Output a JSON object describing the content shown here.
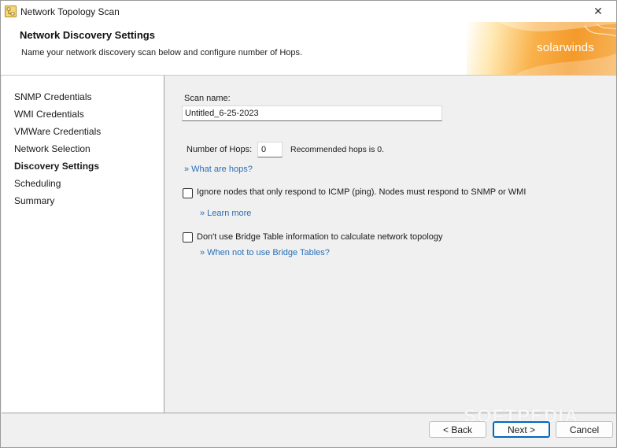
{
  "window": {
    "title": "Network Topology Scan",
    "close_glyph": "✕"
  },
  "header": {
    "title": "Network Discovery Settings",
    "subtitle": "Name your network discovery scan below and configure number of Hops.",
    "brand": "solarwinds"
  },
  "nav": {
    "items": [
      {
        "label": "SNMP Credentials"
      },
      {
        "label": "WMI Credentials"
      },
      {
        "label": "VMWare Credentials"
      },
      {
        "label": "Network Selection"
      },
      {
        "label": "Discovery Settings"
      },
      {
        "label": "Scheduling"
      },
      {
        "label": "Summary"
      }
    ],
    "active": "Discovery Settings"
  },
  "form": {
    "scan_name_label": "Scan name:",
    "scan_name_value": "Untitled_6-25-2023",
    "hops_label": "Number of Hops:",
    "hops_value": "0",
    "hops_hint": "Recommended hops is 0.",
    "hops_link": "» What are hops?",
    "icmp_label": "Ignore nodes that only respond to ICMP (ping). Nodes must respond to SNMP or WMI",
    "icmp_checked": false,
    "icmp_link": "» Learn more",
    "bridge_label": "Don't use Bridge Table information to calculate network topology",
    "bridge_checked": false,
    "bridge_link": "» When not to use Bridge Tables?"
  },
  "footer": {
    "back_label": "< Back",
    "next_label": "Next >",
    "cancel_label": "Cancel"
  },
  "watermark": "SOFTPEDIA",
  "colors": {
    "link": "#2a6fb8",
    "brand_orange": "#f39a2a",
    "primary_border": "#0067c0"
  }
}
